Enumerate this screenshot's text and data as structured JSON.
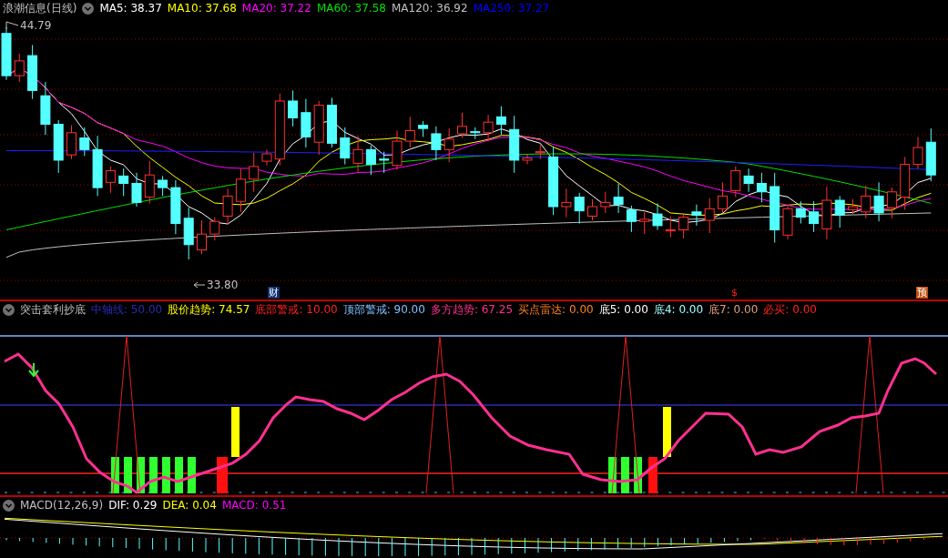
{
  "main_panel": {
    "title": "浪潮信息(日线)",
    "readings": [
      {
        "label": "MA5: 38.37",
        "color": "#ffffff"
      },
      {
        "label": "MA10: 37.68",
        "color": "#ffff00"
      },
      {
        "label": "MA20: 37.22",
        "color": "#ff00ff"
      },
      {
        "label": "MA60: 37.58",
        "color": "#00e000"
      },
      {
        "label": "MA120: 36.92",
        "color": "#c0c0c0"
      },
      {
        "label": "MA250: 37.27",
        "color": "#0000ff"
      }
    ],
    "high_label": "44.79",
    "low_label": "33.80",
    "event_markers": [
      {
        "kind": "finance",
        "text": "财"
      },
      {
        "kind": "dividend",
        "text": "$"
      },
      {
        "kind": "forecast",
        "text": "预"
      }
    ]
  },
  "indicator_panel": {
    "title": "突击套利抄底",
    "readings": [
      {
        "label": "中轴线: 50.00",
        "color": "#2a2ab0"
      },
      {
        "label": "股价趋势: 74.57",
        "color": "#ffff00"
      },
      {
        "label": "底部警戒: 10.00",
        "color": "#ff2020"
      },
      {
        "label": "顶部警戒: 90.00",
        "color": "#80c0ff"
      },
      {
        "label": "多方趋势: 67.25",
        "color": "#ff3090"
      },
      {
        "label": "买点雷达: 0.00",
        "color": "#ff8020"
      },
      {
        "label": "底5: 0.00",
        "color": "#ffffff"
      },
      {
        "label": "底4: 0.00",
        "color": "#a0ffff"
      },
      {
        "label": "底7: 0.00",
        "color": "#e0a080"
      },
      {
        "label": "必买: 0.00",
        "color": "#ff2020"
      }
    ]
  },
  "macd_panel": {
    "title": "MACD(12,26,9)",
    "readings": [
      {
        "label": "DIF: 0.29",
        "color": "#ffffff"
      },
      {
        "label": "DEA: 0.04",
        "color": "#ffff00"
      },
      {
        "label": "MACD: 0.51",
        "color": "#ff00ff"
      }
    ]
  }
}
